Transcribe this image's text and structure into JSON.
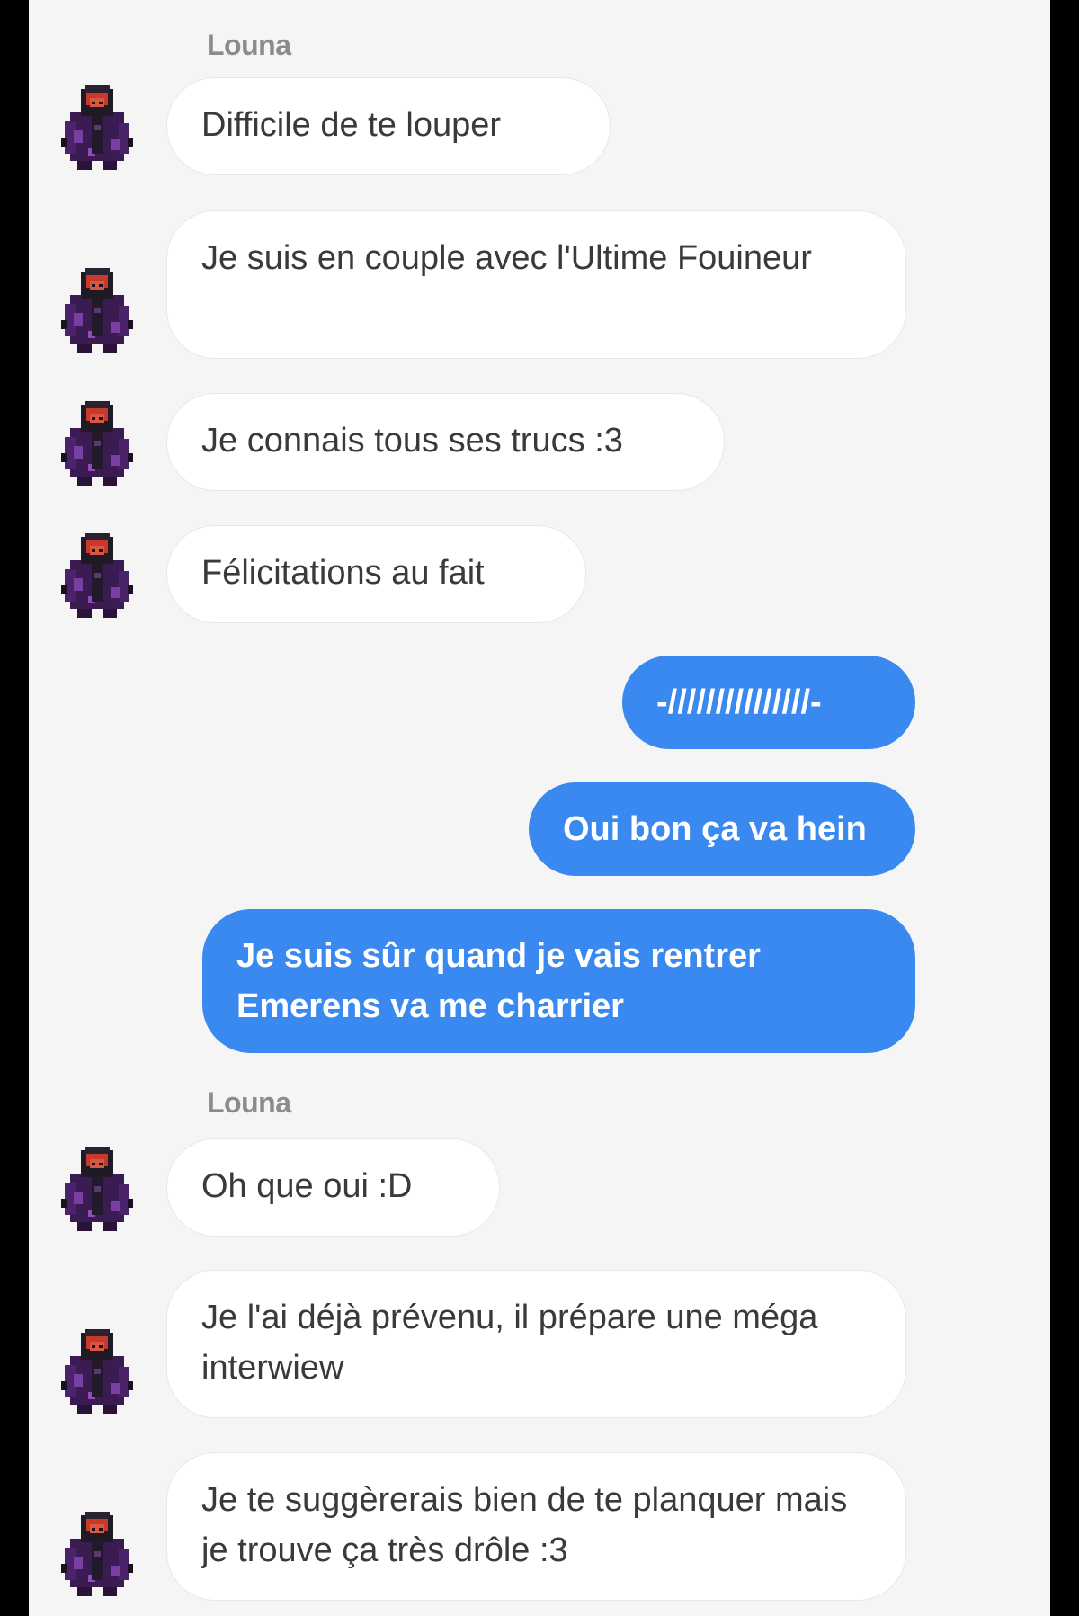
{
  "thread": {
    "messages": [
      {
        "id": "m1",
        "sender": "Louna",
        "text": "Difficile de te louper"
      },
      {
        "id": "m2",
        "sender": "Louna",
        "text": "Je suis en couple avec l'Ultime Fouineur"
      },
      {
        "id": "m3",
        "sender": "Louna",
        "text": "Je connais tous ses trucs :3"
      },
      {
        "id": "m4",
        "sender": "Louna",
        "text": "Félicitations au fait"
      },
      {
        "id": "m5",
        "sender": "me",
        "text": "-///////////////-"
      },
      {
        "id": "m6",
        "sender": "me",
        "text": "Oui bon ça va hein"
      },
      {
        "id": "m7",
        "sender": "me",
        "text": "Je suis sûr quand je vais rentrer Emerens va me charrier"
      },
      {
        "id": "m8",
        "sender": "Louna",
        "text": "Oh que oui :D"
      },
      {
        "id": "m9",
        "sender": "Louna",
        "text": "Je l'ai déjà prévenu, il prépare une méga interwiew"
      },
      {
        "id": "m10",
        "sender": "Louna",
        "text": "Je te suggèrerais bien de te planquer mais je trouve ça très drôle :3"
      }
    ],
    "sender_labels": [
      "Louna",
      "Louna"
    ]
  },
  "colors": {
    "outgoing_bubble": "#3a89f0",
    "incoming_bubble": "#ffffff",
    "page_background": "#f5f5f5",
    "frame": "#000000"
  },
  "icons": {
    "avatar": "pixel-character-avatar-icon"
  }
}
